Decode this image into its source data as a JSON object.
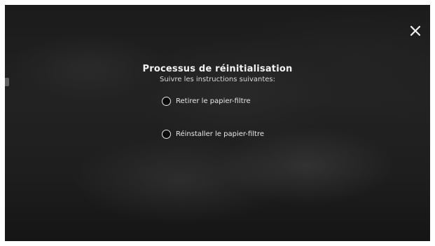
{
  "dialog": {
    "title": "Processus de réinitialisation",
    "subtitle": "Suivre les instructions suivantes:",
    "close_icon": "close-icon"
  },
  "steps": [
    {
      "label": "Retirer le papier-filtre",
      "checked": false
    },
    {
      "label": "Réinstaller le papier-filtre",
      "checked": false
    }
  ],
  "colors": {
    "background": "#1e1e1e",
    "text": "#f2f2f2"
  }
}
